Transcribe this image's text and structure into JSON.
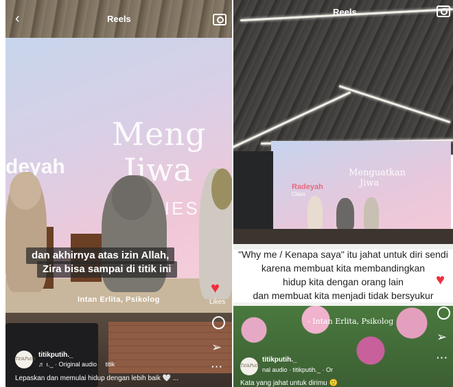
{
  "left": {
    "header": {
      "title": "Reels"
    },
    "backdrop": {
      "brand": "deyah",
      "title_line1": "Meng",
      "title_line2": "Jiwa",
      "title_line3": "RIES"
    },
    "captions": [
      "dan akhirnya atas izin Allah,",
      "Zira bisa sampai di titik ini"
    ],
    "speaker": "Intan Erlita, Psikolog",
    "likes_label": "Likes",
    "avatar_text": "TitikPutih",
    "username": "titikputih._",
    "audio": "♬  ı._ · Original audio",
    "audio_extra": "titik",
    "description": "Lepaskan dan memulai hidup dengan lebih baik 🤍 ..."
  },
  "right": {
    "header": {
      "title": "Reels"
    },
    "backdrop": {
      "brand": "Radeyah",
      "brand_sub": "Class",
      "title_line1": "Menguatkan",
      "title_line2": "Jiwa"
    },
    "captions": [
      "\"Why me / Kenapa saya\" itu jahat untuk diri sendi",
      "karena membuat kita membandingkan",
      "hidup kita dengan orang lain",
      "dan membuat kita menjadi tidak bersyukur"
    ],
    "speaker": "- Intan Erlita, Psikolog",
    "avatar_text": "TitikPutih",
    "username": "titikputih._",
    "audio": "nal audio · titikputih._ · Or",
    "description": "Kata yang jahat untuk dirimu 🙂"
  },
  "colors": {
    "heart": "#ee2e3c"
  }
}
